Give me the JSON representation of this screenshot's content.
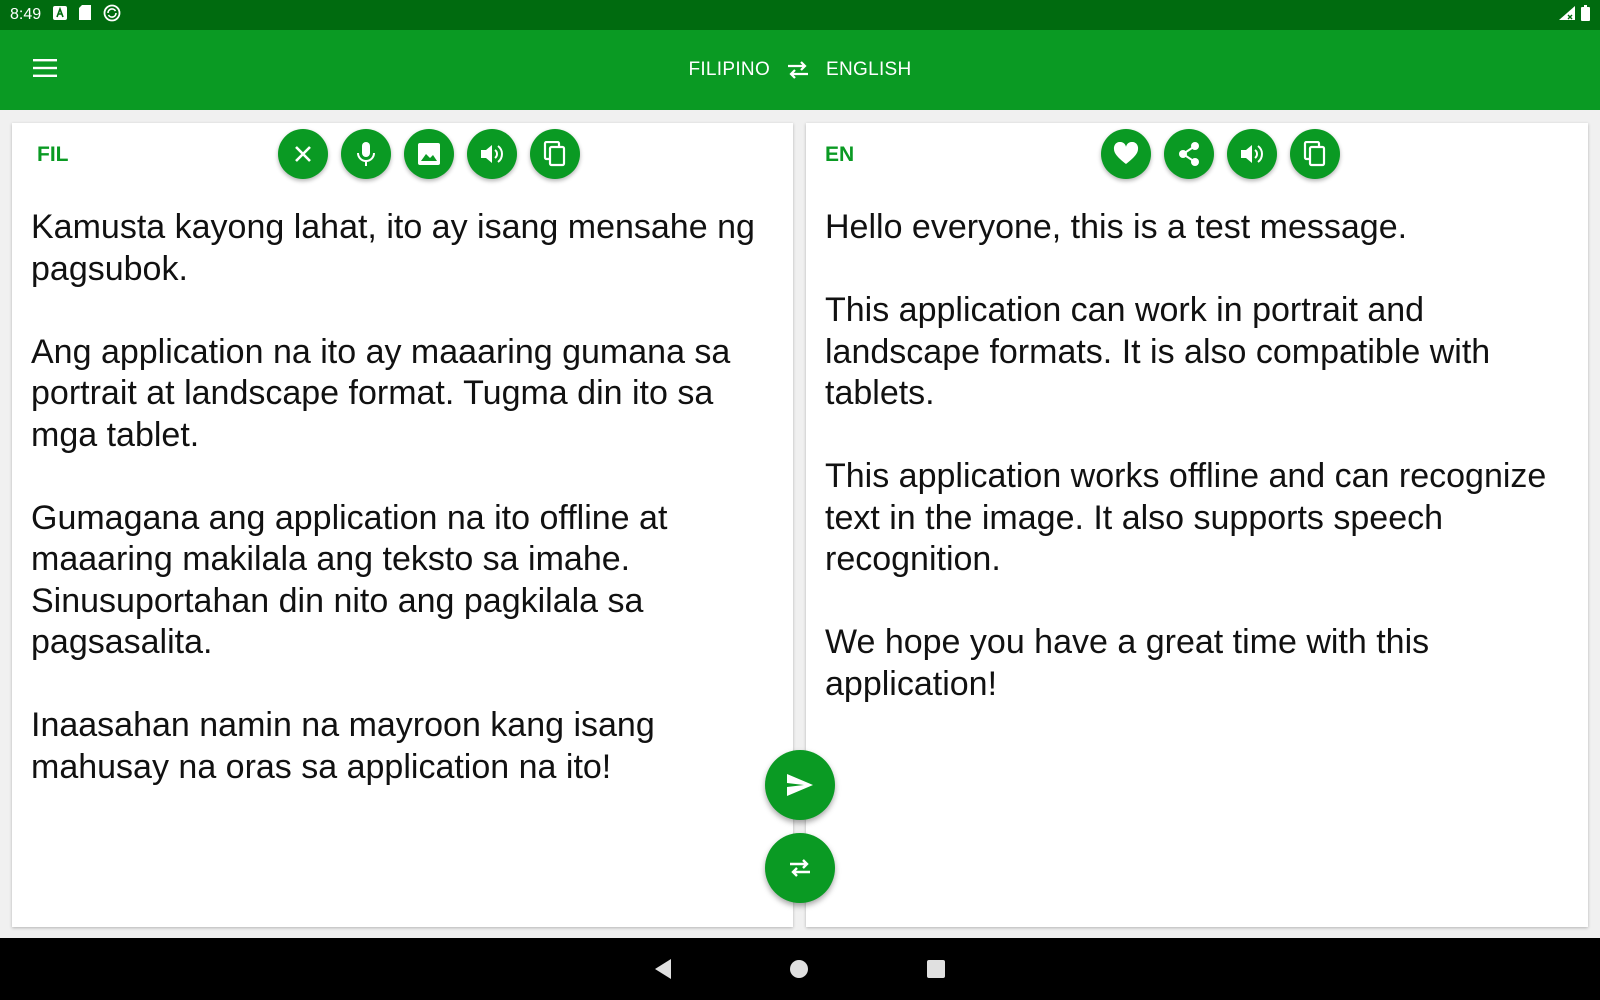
{
  "status_bar": {
    "time": "8:49",
    "icons_left": [
      "text-a-icon",
      "sd-card-icon",
      "sync-icon"
    ],
    "icons_right": [
      "signal-icon",
      "battery-icon"
    ]
  },
  "app_bar": {
    "source_language": "FILIPINO",
    "target_language": "ENGLISH",
    "menu_icon": "menu-icon",
    "swap_icon": "swap-arrows-icon"
  },
  "source_panel": {
    "code": "FIL",
    "actions": [
      "clear",
      "microphone",
      "image",
      "speak",
      "copy"
    ],
    "paragraphs": [
      "Kamusta kayong lahat, ito ay isang mensahe ng pagsubok.",
      "Ang application na ito ay maaaring gumana sa portrait at landscape format. Tugma din ito sa mga tablet.",
      "Gumagana ang application na ito offline at maaaring makilala ang teksto sa imahe. Sinusuportahan din nito ang pagkilala sa pagsasalita.",
      "Inaasahan namin na mayroon kang isang mahusay na oras sa application na ito!"
    ]
  },
  "target_panel": {
    "code": "EN",
    "actions": [
      "favorite",
      "share",
      "speak",
      "copy"
    ],
    "paragraphs": [
      "Hello everyone, this is a test message.",
      "This application can work in portrait and landscape formats. It is also compatible with tablets.",
      "This application works offline and can recognize text in the image. It also supports speech recognition.",
      "We hope you have a great time with this application!"
    ]
  },
  "fabs": [
    "send-icon",
    "swap-icon"
  ],
  "nav_bar": [
    "back",
    "home",
    "recents"
  ],
  "colors": {
    "primary": "#0a9a23",
    "status_bar": "#006b0f",
    "nav_bar": "#000000",
    "panel_bg": "#ffffff",
    "page_bg": "#f0f0f0"
  }
}
